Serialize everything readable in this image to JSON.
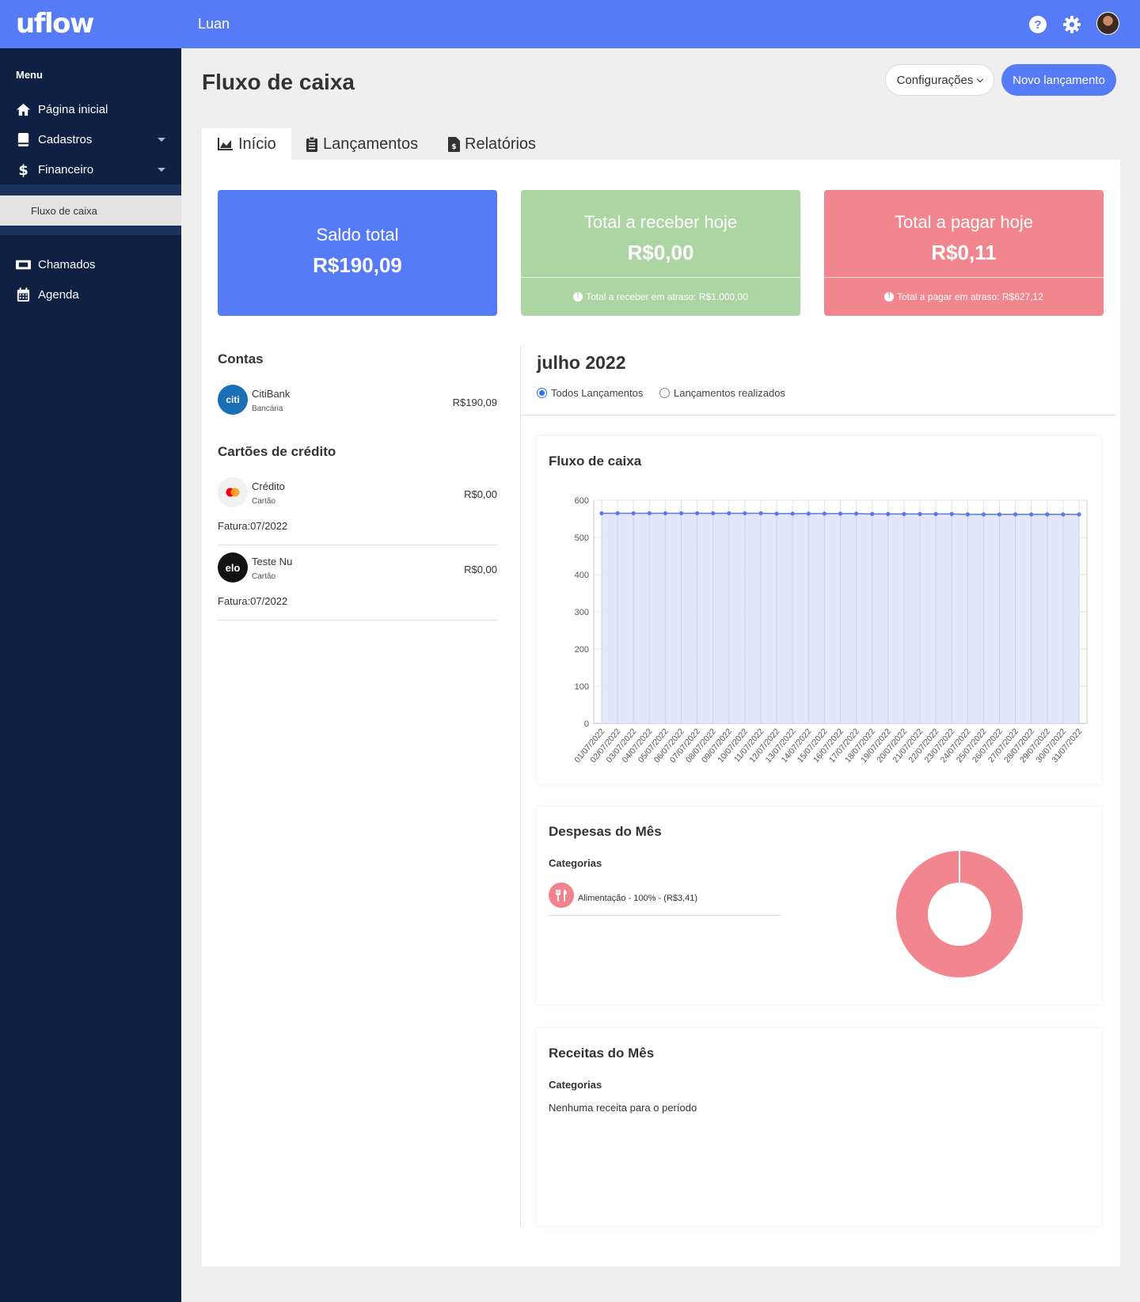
{
  "topbar": {
    "logo": "uflow",
    "user_name": "Luan",
    "brand_color": "#557bf7",
    "icons": [
      "help-icon",
      "gear-icon",
      "avatar"
    ]
  },
  "sidebar": {
    "menu_title": "Menu",
    "items": [
      {
        "label": "Página inicial",
        "icon": "home-icon"
      },
      {
        "label": "Cadastros",
        "icon": "book-icon",
        "expandable": true
      },
      {
        "label": "Financeiro",
        "icon": "dollar-icon",
        "expandable": true
      },
      {
        "label": "Chamados",
        "icon": "ticket-icon"
      },
      {
        "label": "Agenda",
        "icon": "calendar-icon"
      }
    ],
    "sub_item": "Fluxo de caixa"
  },
  "header": {
    "title": "Fluxo de caixa",
    "config_label": "Configurações",
    "new_label": "Novo lançamento"
  },
  "tabs": [
    {
      "label": "Início",
      "icon": "area-chart-icon",
      "active": true
    },
    {
      "label": "Lançamentos",
      "icon": "clipboard-icon",
      "active": false
    },
    {
      "label": "Relatórios",
      "icon": "invoice-icon",
      "active": false
    }
  ],
  "cards": {
    "saldo": {
      "title": "Saldo total",
      "value": "R$190,09",
      "color": "#557bf7"
    },
    "receber": {
      "title": "Total a receber hoje",
      "value": "R$0,00",
      "footer": "Total a receber em atraso: R$1.000,00",
      "color": "#add5a3"
    },
    "pagar": {
      "title": "Total a pagar hoje",
      "value": "R$0,11",
      "footer": "Total a pagar em atraso: R$627,12",
      "color": "#f1868f"
    }
  },
  "contas": {
    "title": "Contas",
    "items": [
      {
        "logo": "citi",
        "name": "CitiBank",
        "type": "Bancária",
        "value": "R$190,09"
      }
    ]
  },
  "cartoes": {
    "title": "Cartões de crédito",
    "items": [
      {
        "logo": "mastercard",
        "name": "Crédito",
        "type": "Cartão",
        "value": "R$0,00",
        "fatura": "Fatura:07/2022"
      },
      {
        "logo": "elo",
        "name": "Teste Nu",
        "type": "Cartão",
        "value": "R$0,00",
        "fatura": "Fatura:07/2022"
      }
    ]
  },
  "period": {
    "month": "julho 2022",
    "filters": [
      {
        "label": "Todos Lançamentos",
        "selected": true
      },
      {
        "label": "Lançamentos realizados",
        "selected": false
      }
    ]
  },
  "fluxo": {
    "title": "Fluxo de caixa"
  },
  "chart_data": [
    {
      "type": "area",
      "title": "Fluxo de caixa",
      "x": [
        "01/07/2022",
        "02/07/2022",
        "03/07/2022",
        "04/07/2022",
        "05/07/2022",
        "06/07/2022",
        "07/07/2022",
        "08/07/2022",
        "09/07/2022",
        "10/07/2022",
        "11/07/2022",
        "12/07/2022",
        "13/07/2022",
        "14/07/2022",
        "15/07/2022",
        "16/07/2022",
        "17/07/2022",
        "18/07/2022",
        "19/07/2022",
        "20/07/2022",
        "21/07/2022",
        "22/07/2022",
        "23/07/2022",
        "24/07/2022",
        "25/07/2022",
        "26/07/2022",
        "27/07/2022",
        "28/07/2022",
        "29/07/2022",
        "30/07/2022",
        "31/07/2022"
      ],
      "values": [
        565,
        565,
        565,
        565,
        565,
        565,
        565,
        565,
        565,
        565,
        565,
        564,
        564,
        564,
        564,
        564,
        564,
        563,
        563,
        563,
        563,
        563,
        563,
        562,
        562,
        562,
        562,
        562,
        562,
        562,
        562
      ],
      "ylim": [
        0,
        600
      ],
      "yticks": [
        0,
        100,
        200,
        300,
        400,
        500,
        600
      ],
      "grid": true,
      "color": "#5a78e8",
      "fill": "#dde3fb"
    },
    {
      "type": "pie",
      "title": "Despesas do Mês",
      "categories": [
        "Alimentação"
      ],
      "values": [
        3.41
      ],
      "color": "#f1868f"
    }
  ],
  "despesas": {
    "title": "Despesas do Mês",
    "sub": "Categorias",
    "items": [
      {
        "label": "Alimentação - 100% - (R$3,41)",
        "icon": "utensils-icon"
      }
    ]
  },
  "receitas": {
    "title": "Receitas do Mês",
    "sub": "Categorias",
    "empty": "Nenhuma receita para o período"
  }
}
